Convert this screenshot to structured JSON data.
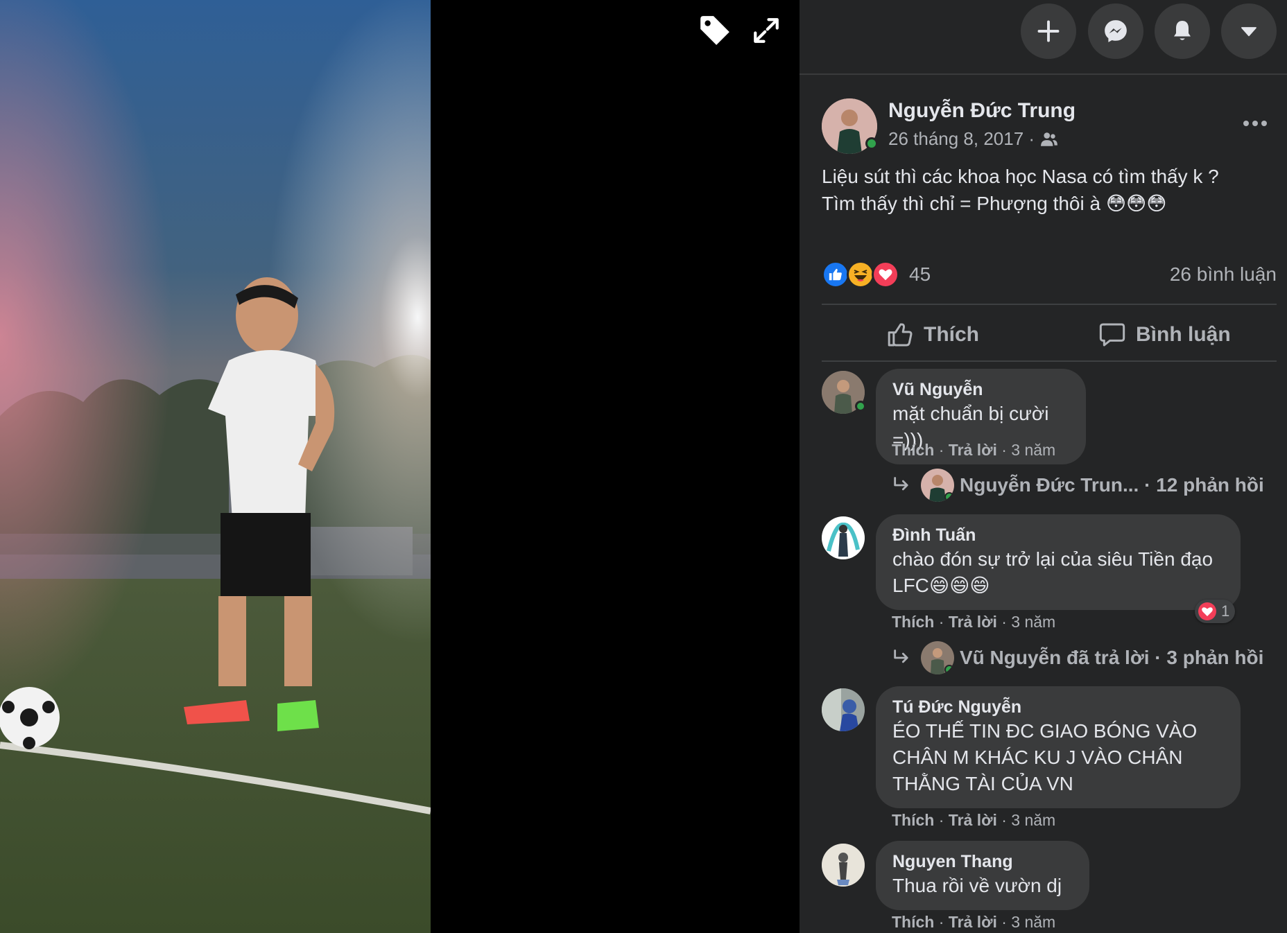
{
  "viewer": {
    "tag_icon": "tag-icon",
    "expand_icon": "expand-icon"
  },
  "topbar": {
    "create_icon": "plus-icon",
    "messenger_icon": "messenger-icon",
    "notifications_icon": "bell-icon",
    "account_icon": "caret-down-icon"
  },
  "post": {
    "author": "Nguyễn Đức Trung",
    "date": "26 tháng 8, 2017 ·",
    "audience_icon": "friends-icon",
    "text": "Liệu sút thì các khoa học Nasa có tìm thấy k ?\nTìm thấy thì chỉ = Phượng thôi à 😳😳😳",
    "reaction_count": "45",
    "comment_count": "26 bình luận",
    "like_label": "Thích",
    "comment_label": "Bình luận"
  },
  "comments": [
    {
      "name": "Vũ Nguyễn",
      "text": "mặt chuẩn bị cười =)))",
      "like": "Thích",
      "reply": "Trả lời",
      "time": "3 năm",
      "replies_text": "Nguyễn Đức Trun... · 12 phản hồi"
    },
    {
      "name": "Đình Tuấn",
      "text": "chào đón sự trở lại của siêu Tiền đạo LFC😄😄😄",
      "like": "Thích",
      "reply": "Trả lời",
      "time": "3 năm",
      "reaction_count": "1",
      "replies_text": "Vũ Nguyễn đã trả lời · 3 phản hồi"
    },
    {
      "name": "Tú Đức Nguyễn",
      "text": "ÉO THẾ TIN ĐC GIAO BÓNG VÀO CHÂN M KHÁC KU J VÀO CHÂN THẰNG TÀI CỦA VN",
      "like": "Thích",
      "reply": "Trả lời",
      "time": "3 năm"
    },
    {
      "name": "Nguyen Thang",
      "text": "Thua rồi về vườn dj",
      "like": "Thích",
      "reply": "Trả lời",
      "time": "3 năm"
    }
  ],
  "separator": "·",
  "colors": {
    "panel_bg": "#242526",
    "bubble_bg": "#3a3b3c",
    "text_primary": "#e4e6eb",
    "text_secondary": "#b0b3b8",
    "online_green": "#31a24c",
    "like_blue": "#1877f2",
    "love_red": "#f33e58"
  }
}
